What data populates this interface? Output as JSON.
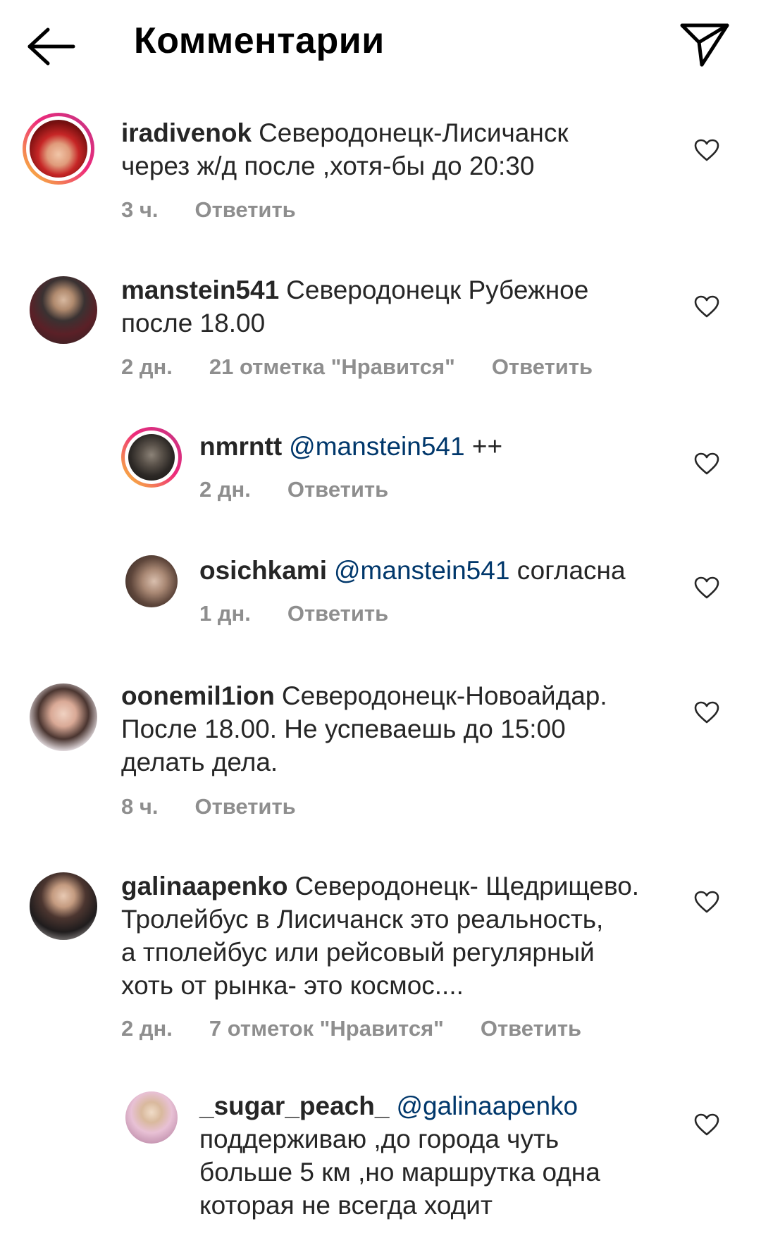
{
  "header": {
    "title": "Комментарии"
  },
  "comments": [
    {
      "username": "iradivenok",
      "text": "Северодонецк-Лисичанск",
      "text2": "через ж/д после ,хотя-бы до 20:30",
      "time": "3 ч.",
      "reply": "Ответить"
    },
    {
      "username": "manstein541",
      "text": "Северодонецк Рубежное",
      "text2": "после 18.00",
      "time": "2 дн.",
      "likes": "21 отметка \"Нравится\"",
      "reply": "Ответить"
    },
    {
      "username": "nmrntt",
      "mention": "@manstein541",
      "text": "++",
      "time": "2 дн.",
      "reply": "Ответить"
    },
    {
      "username": "osichkami",
      "mention": "@manstein541",
      "text": "согласна",
      "time": "1 дн.",
      "reply": "Ответить"
    },
    {
      "username": "oonemil1ion",
      "text": "Северодонецк-Новоайдар.",
      "text2": "После 18.00. Не успеваешь до 15:00",
      "text3": "делать дела.",
      "time": "8 ч.",
      "reply": "Ответить"
    },
    {
      "username": "galinaapenko",
      "text": "Северодонецк- Щедрищево.",
      "text2": "Тролейбус в Лисичанск это реальность,",
      "text3": "а тполейбус или рейсовый регулярный",
      "text4": "хоть от рынка- это космос....",
      "time": "2 дн.",
      "likes": "7 отметок \"Нравится\"",
      "reply": "Ответить"
    },
    {
      "username": "_sugar_peach_",
      "mention": "@galinaapenko",
      "text2": "поддерживаю ,до города чуть",
      "text3": "больше 5 км ,но маршрутка одна",
      "text4": "которая не всегда ходит"
    }
  ]
}
